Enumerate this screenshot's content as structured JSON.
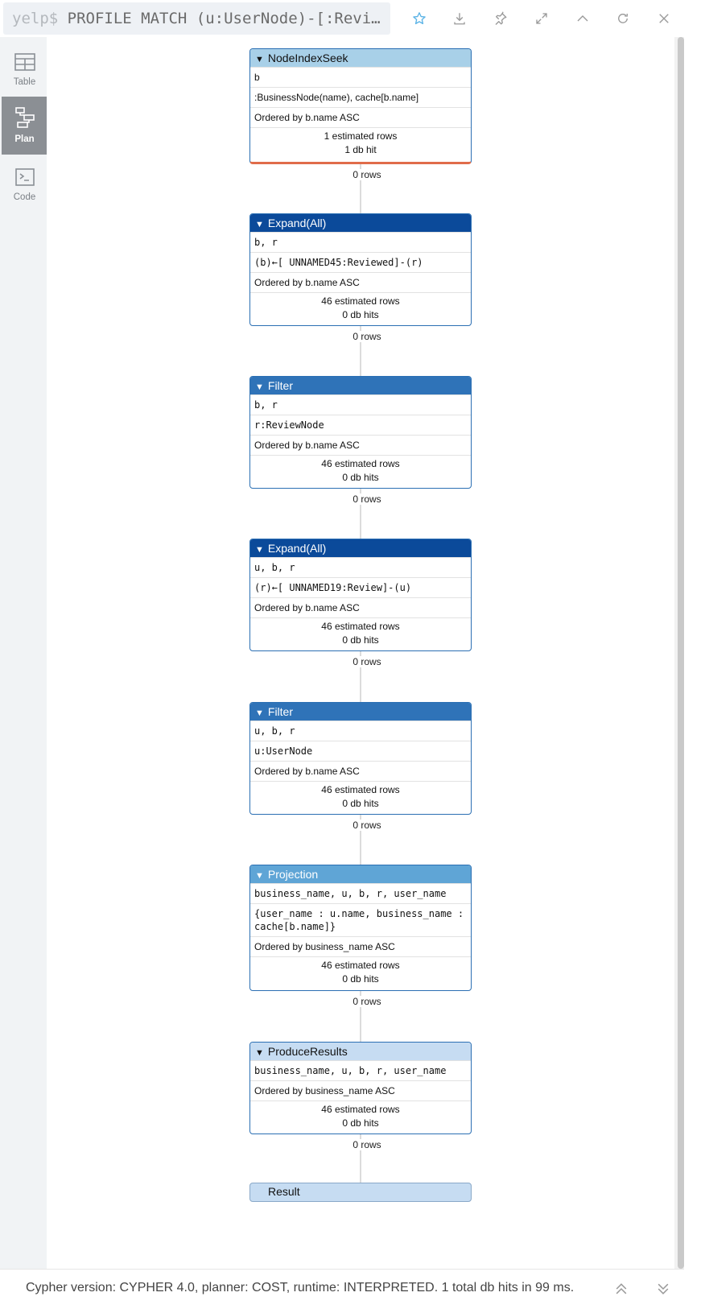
{
  "query": {
    "prompt": "yelp$",
    "text": "PROFILE MATCH (u:UserNode)-[:Revi…"
  },
  "toolbar": {
    "icons": [
      "star-icon",
      "download-icon",
      "pin-icon",
      "expand-icon",
      "collapse-up-icon",
      "rerun-icon",
      "close-icon"
    ],
    "star_color": "#5ab3e6"
  },
  "sidebar": {
    "items": [
      {
        "label": "Table",
        "icon": "table-icon"
      },
      {
        "label": "Plan",
        "icon": "plan-icon",
        "active": true
      },
      {
        "label": "Code",
        "icon": "code-icon"
      }
    ]
  },
  "plan": {
    "operators": [
      {
        "name": "NodeIndexSeek",
        "color": "#a8d0e8",
        "text_color": "#111111",
        "rows": [
          {
            "text": "b",
            "mono": false
          },
          {
            "text": ":BusinessNode(name), cache[b.name]",
            "mono": false
          },
          {
            "text": "Ordered by b.name ASC",
            "mono": false
          }
        ],
        "estimated": "1 estimated rows",
        "hits": "1 db hit",
        "out_rows": "0 rows",
        "highlight": "#e06c4a"
      },
      {
        "name": "Expand(All)",
        "color": "#0b4a9a",
        "text_color": "#ffffff",
        "rows": [
          {
            "text": "b, r",
            "mono": true
          },
          {
            "text": "(b)←[ UNNAMED45:Reviewed]-(r)",
            "mono": true
          },
          {
            "text": "Ordered by b.name ASC",
            "mono": false
          }
        ],
        "estimated": "46 estimated rows",
        "hits": "0 db hits",
        "out_rows": "0 rows"
      },
      {
        "name": "Filter",
        "color": "#2f73b8",
        "text_color": "#ffffff",
        "rows": [
          {
            "text": "b, r",
            "mono": true
          },
          {
            "text": "r:ReviewNode",
            "mono": true
          },
          {
            "text": "Ordered by b.name ASC",
            "mono": false
          }
        ],
        "estimated": "46 estimated rows",
        "hits": "0 db hits",
        "out_rows": "0 rows"
      },
      {
        "name": "Expand(All)",
        "color": "#0b4a9a",
        "text_color": "#ffffff",
        "rows": [
          {
            "text": "u, b, r",
            "mono": true
          },
          {
            "text": "(r)←[ UNNAMED19:Review]-(u)",
            "mono": true
          },
          {
            "text": "Ordered by b.name ASC",
            "mono": false
          }
        ],
        "estimated": "46 estimated rows",
        "hits": "0 db hits",
        "out_rows": "0 rows"
      },
      {
        "name": "Filter",
        "color": "#2f73b8",
        "text_color": "#ffffff",
        "rows": [
          {
            "text": "u, b, r",
            "mono": true
          },
          {
            "text": "u:UserNode",
            "mono": true
          },
          {
            "text": "Ordered by b.name ASC",
            "mono": false
          }
        ],
        "estimated": "46 estimated rows",
        "hits": "0 db hits",
        "out_rows": "0 rows"
      },
      {
        "name": "Projection",
        "color": "#5fa5d6",
        "text_color": "#ffffff",
        "rows": [
          {
            "text": "business_name, u, b, r, user_name",
            "mono": true
          },
          {
            "text": "{user_name : u.name, business_name : cache[b.name]}",
            "mono": true
          },
          {
            "text": "Ordered by business_name ASC",
            "mono": false
          }
        ],
        "estimated": "46 estimated rows",
        "hits": "0 db hits",
        "out_rows": "0 rows"
      },
      {
        "name": "ProduceResults",
        "color": "#c6dcf2",
        "text_color": "#111111",
        "rows": [
          {
            "text": "business_name, u, b, r, user_name",
            "mono": true
          },
          {
            "text": "Ordered by business_name ASC",
            "mono": false
          }
        ],
        "estimated": "46 estimated rows",
        "hits": "0 db hits",
        "out_rows": "0 rows"
      }
    ],
    "result_label": "Result"
  },
  "footer": {
    "status": "Cypher version: CYPHER 4.0, planner: COST, runtime: INTERPRETED. 1 total db hits in 99 ms."
  }
}
